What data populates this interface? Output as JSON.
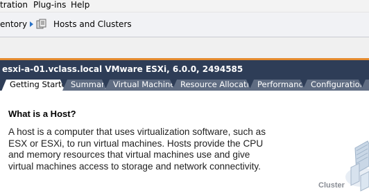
{
  "menu": {
    "items": [
      "tration",
      "Plug-ins",
      "Help"
    ]
  },
  "nav": {
    "breadcrumb_root": "entory",
    "breadcrumb_current": "Hosts and Clusters"
  },
  "title_bar": {
    "host_title": "esxi-a-01.vclass.local VMware ESXi, 6.0.0, 2494585"
  },
  "tabs": [
    {
      "label": "Getting Started",
      "active": true
    },
    {
      "label": "Summary",
      "active": false
    },
    {
      "label": "Virtual Machines",
      "active": false
    },
    {
      "label": "Resource Allocation",
      "active": false
    },
    {
      "label": "Performance",
      "active": false
    },
    {
      "label": "Configuration",
      "active": false
    }
  ],
  "content": {
    "heading": "What is a Host?",
    "paragraph": "A host is a computer that uses virtualization software, such as ESX or ESXi, to run virtual machines. Hosts provide the CPU and memory resources that virtual machines use and give virtual machines access to storage and network connectivity.",
    "diagram_label": "Cluster"
  },
  "colors": {
    "title_bar": "#2e3d57",
    "tab_inactive": "#5f6c82",
    "accent_line": "#e58b2e"
  }
}
